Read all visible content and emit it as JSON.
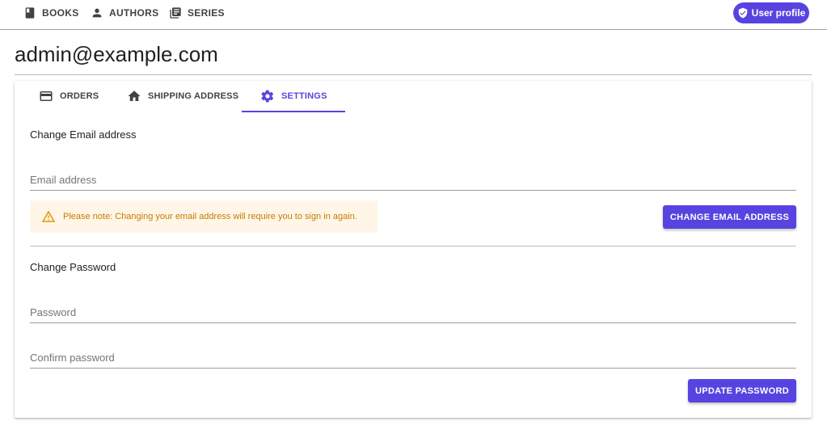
{
  "nav": {
    "items": [
      {
        "label": "BOOKS",
        "icon": "book-icon"
      },
      {
        "label": "AUTHORS",
        "icon": "person-icon"
      },
      {
        "label": "SERIES",
        "icon": "library-icon"
      }
    ],
    "user_profile_label": "User profile",
    "user_profile_icon": "shield-check-icon"
  },
  "page": {
    "title": "admin@example.com"
  },
  "tabs": [
    {
      "label": "ORDERS",
      "icon": "credit-card-icon",
      "active": false
    },
    {
      "label": "SHIPPING ADDRESS",
      "icon": "home-icon",
      "active": false
    },
    {
      "label": "SETTINGS",
      "icon": "gear-icon",
      "active": true
    }
  ],
  "email_section": {
    "title": "Change Email address",
    "email_placeholder": "Email address",
    "email_value": "",
    "notice": "Please note: Changing your email address will require you to sign in again.",
    "button_label": "CHANGE EMAIL ADDRESS"
  },
  "password_section": {
    "title": "Change Password",
    "password_placeholder": "Password",
    "confirm_placeholder": "Confirm password",
    "button_label": "UPDATE PASSWORD"
  },
  "colors": {
    "accent": "#5744e0",
    "warning_bg": "#fff6e8",
    "warning_text": "#c77a00"
  }
}
